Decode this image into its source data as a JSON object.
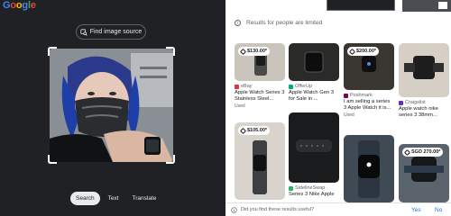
{
  "logo": {
    "letters": [
      "G",
      "o",
      "o",
      "g",
      "l",
      "e"
    ],
    "colors": [
      "#4285f4",
      "#ea4335",
      "#fbbc05",
      "#4285f4",
      "#34a853",
      "#ea4335"
    ]
  },
  "left": {
    "find_source_label": "Find image source",
    "tabs": [
      {
        "label": "Search",
        "active": true
      },
      {
        "label": "Text",
        "active": false
      },
      {
        "label": "Translate",
        "active": false
      }
    ]
  },
  "right": {
    "notice": "Results for people are limited",
    "cards": [
      {
        "price": "$130.00*",
        "source": "eBay",
        "title": "Apple Watch Series 3 Stainless Steel...",
        "sub": "Used",
        "src_color": "#e53238"
      },
      {
        "price": "",
        "source": "OfferUp",
        "title": "Apple Watch Gen 3 for Sale in ...",
        "sub": "",
        "src_color": "#00ab80"
      },
      {
        "price": "$200.00*",
        "source": "Poshmark",
        "title": "I am selling a series 3 Apple Watch it is...",
        "sub": "Used",
        "src_color": "#7f0353"
      },
      {
        "price": "",
        "source": "Craigslist",
        "title": "Apple watch nike series 3 38mm...",
        "sub": "",
        "src_color": "#6a2db5"
      },
      {
        "price": "$105.00*",
        "source": "",
        "title": "",
        "sub": "",
        "src_color": "#ffffff"
      },
      {
        "price": "",
        "source": "SidelineSwap",
        "title": "Series 3 Nike Apple",
        "sub": "",
        "src_color": "#26b36a"
      },
      {
        "price": "",
        "source": "",
        "title": "",
        "sub": "",
        "src_color": "#ffffff"
      },
      {
        "price": "SGD 270.00*",
        "source": "",
        "title": "",
        "sub": "",
        "src_color": "#ffffff"
      }
    ],
    "feedback": {
      "question": "Did you find these results useful?",
      "yes": "Yes",
      "no": "No"
    }
  }
}
